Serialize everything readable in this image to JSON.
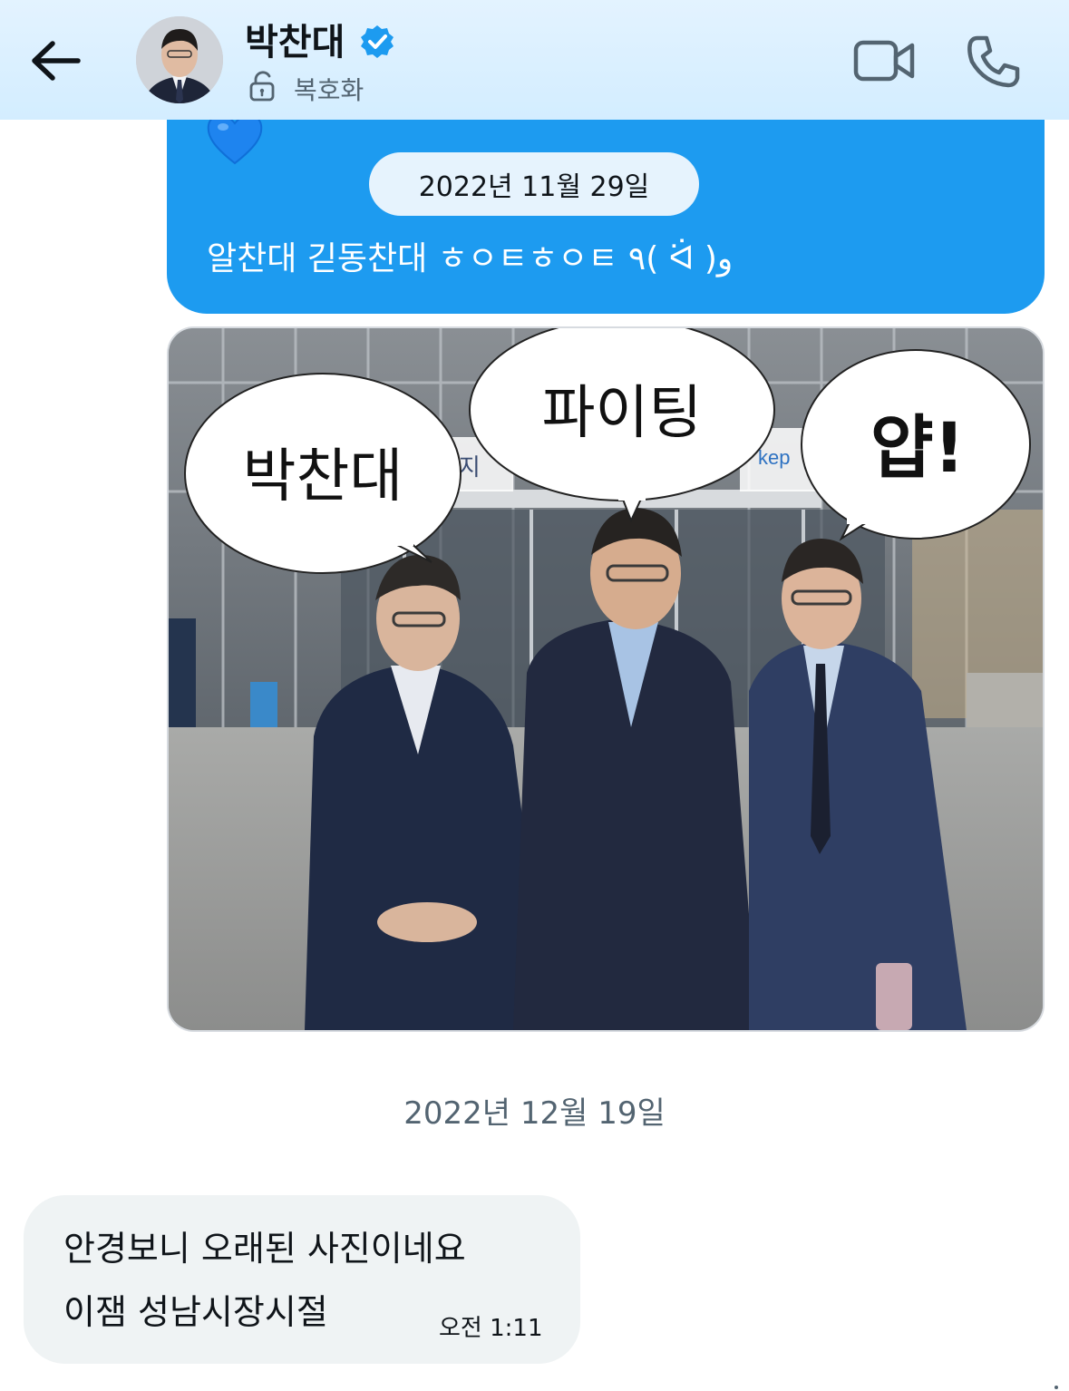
{
  "header": {
    "name": "박찬대",
    "encryption_label": "복호화",
    "background": "#dbefff"
  },
  "conversation": {
    "sent_message": {
      "date_separator": "2022년 11월 29일",
      "text": "알찬대 긷동찬대 ㅎㅇㅌㅎㅇㅌ ٩( ᐛ )و",
      "bubble_color": "#1d9bf0"
    },
    "photo": {
      "speech_bubbles": [
        "박찬대",
        "파이팅",
        "얍!"
      ],
      "sign_text": "번지",
      "sign_logo": "kep"
    },
    "date_separator_2": "2022년 12월 19일",
    "received_message": {
      "lines": [
        "안경보니 오래된 사진이네요",
        "이잼 성남시장시절"
      ],
      "time": "오전 1:11",
      "bubble_color": "#eff3f4"
    }
  },
  "icons": {
    "back": "arrow-left-icon",
    "verified": "verified-badge-icon",
    "lock": "unlock-icon",
    "video": "video-camera-icon",
    "call": "phone-icon",
    "heart": "blue-heart-icon"
  },
  "colors": {
    "accent": "#1d9bf0",
    "text_primary": "#0f1419",
    "text_secondary": "#536471"
  }
}
